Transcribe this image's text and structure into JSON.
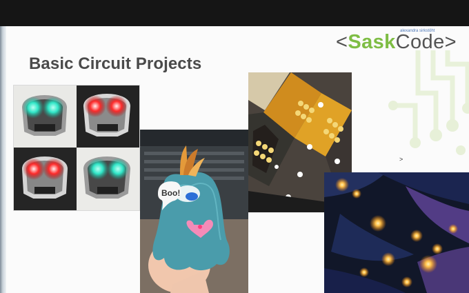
{
  "slide": {
    "title": "Basic Circuit Projects"
  },
  "brand": {
    "small_text": "alexandra sirkstöht",
    "left_bracket": "<",
    "sask": "Sask",
    "code": "Code",
    "right_bracket": ">",
    "color_green": "#7ebd44",
    "color_gray": "#505050"
  },
  "photos": {
    "monster_bubble": "Boo!"
  },
  "colors": {
    "background": "#fbfbfb",
    "topbar": "#151515",
    "title": "#4a4a4a"
  }
}
